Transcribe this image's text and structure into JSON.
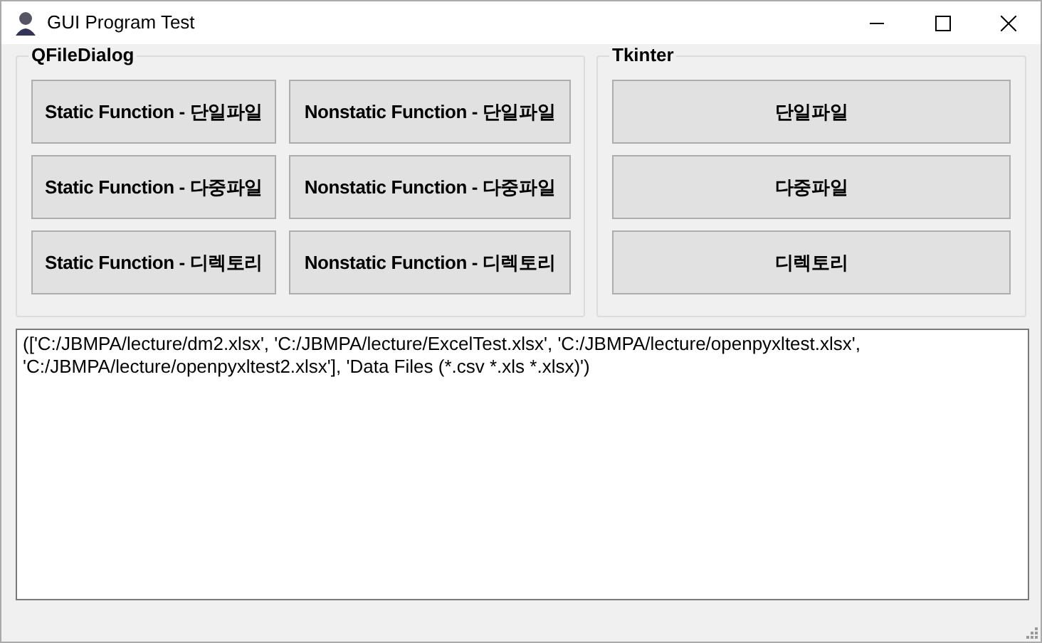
{
  "window": {
    "title": "GUI Program Test"
  },
  "groups": [
    {
      "title": "QFileDialog",
      "kind": "pair",
      "buttons": [
        "Static Function - 단일파일",
        "Nonstatic Function - 단일파일",
        "Static Function - 다중파일",
        "Nonstatic Function - 다중파일",
        "Static Function - 디렉토리",
        "Nonstatic Function - 디렉토리"
      ]
    },
    {
      "title": "Tkinter",
      "kind": "single",
      "buttons": [
        "단일파일",
        "다중파일",
        "디렉토리"
      ]
    }
  ],
  "output": {
    "value": "(['C:/JBMPA/lecture/dm2.xlsx', 'C:/JBMPA/lecture/ExcelTest.xlsx', 'C:/JBMPA/lecture/openpyxltest.xlsx', 'C:/JBMPA/lecture/openpyxltest2.xlsx'], 'Data Files (*.csv *.xls *.xlsx)')"
  }
}
